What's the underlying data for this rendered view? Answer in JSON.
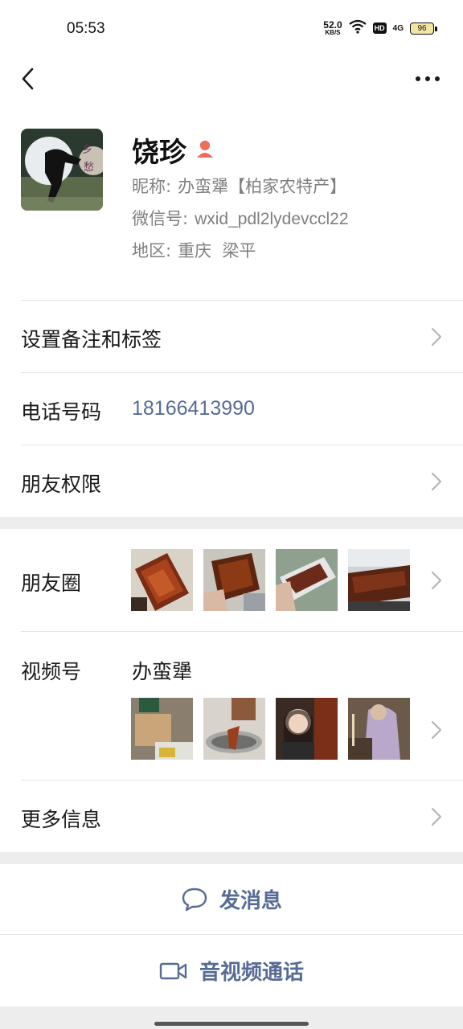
{
  "status_bar": {
    "time": "05:53",
    "net_speed_value": "52.0",
    "net_speed_unit": "KB/S",
    "hd_label": "HD",
    "signal_label": "4G",
    "battery": "96"
  },
  "nav": {
    "back_icon": "chevron-left-icon",
    "more_icon": "more-dots-icon"
  },
  "profile": {
    "name": "饶珍",
    "gender_icon": "female-person-icon",
    "nickname_label": "昵称:",
    "nickname": "办蛮犟【柏家农特产】",
    "wechat_id_label": "微信号:",
    "wechat_id": "wxid_pdl2lydevccl22",
    "region_label": "地区:",
    "region": "重庆  梁平"
  },
  "rows": {
    "remark_label": "设置备注和标签",
    "phone_label": "电话号码",
    "phone_value": "18166413990",
    "permission_label": "朋友权限",
    "moments_label": "朋友圈",
    "channels_label": "视频号",
    "channels_name": "办蛮犟",
    "more_info_label": "更多信息"
  },
  "actions": {
    "message_label": "发消息",
    "call_label": "音视频通话"
  },
  "colors": {
    "accent_link": "#576b95",
    "gender_icon": "#f06c5b",
    "background": "#ededed"
  }
}
